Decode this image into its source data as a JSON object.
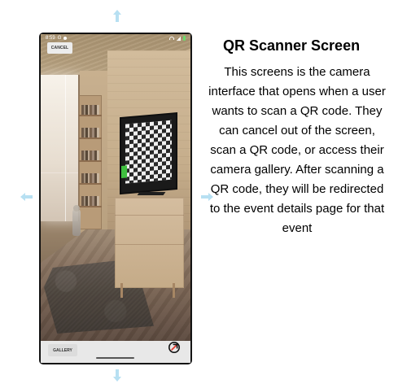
{
  "screen": {
    "status_time": "8:59",
    "status_left_extra": "G",
    "cancel_label": "CANCEL",
    "gallery_label": "GALLERY",
    "scan_icon": "qr-scan-icon"
  },
  "right_panel": {
    "title": "QR Scanner Screen",
    "description": "This screens is the camera interface that opens when a user wants to scan a QR code. They can cancel out of the screen, scan a QR code, or access their camera gallery. After scanning a QR code, they will be redirected to the event details page for that event"
  },
  "colors": {
    "arrow": "#b7e0f2",
    "bottom_bar": "#e8e8e8",
    "scan_red": "#e23b2f",
    "tv_green": "#3fbf3f"
  }
}
